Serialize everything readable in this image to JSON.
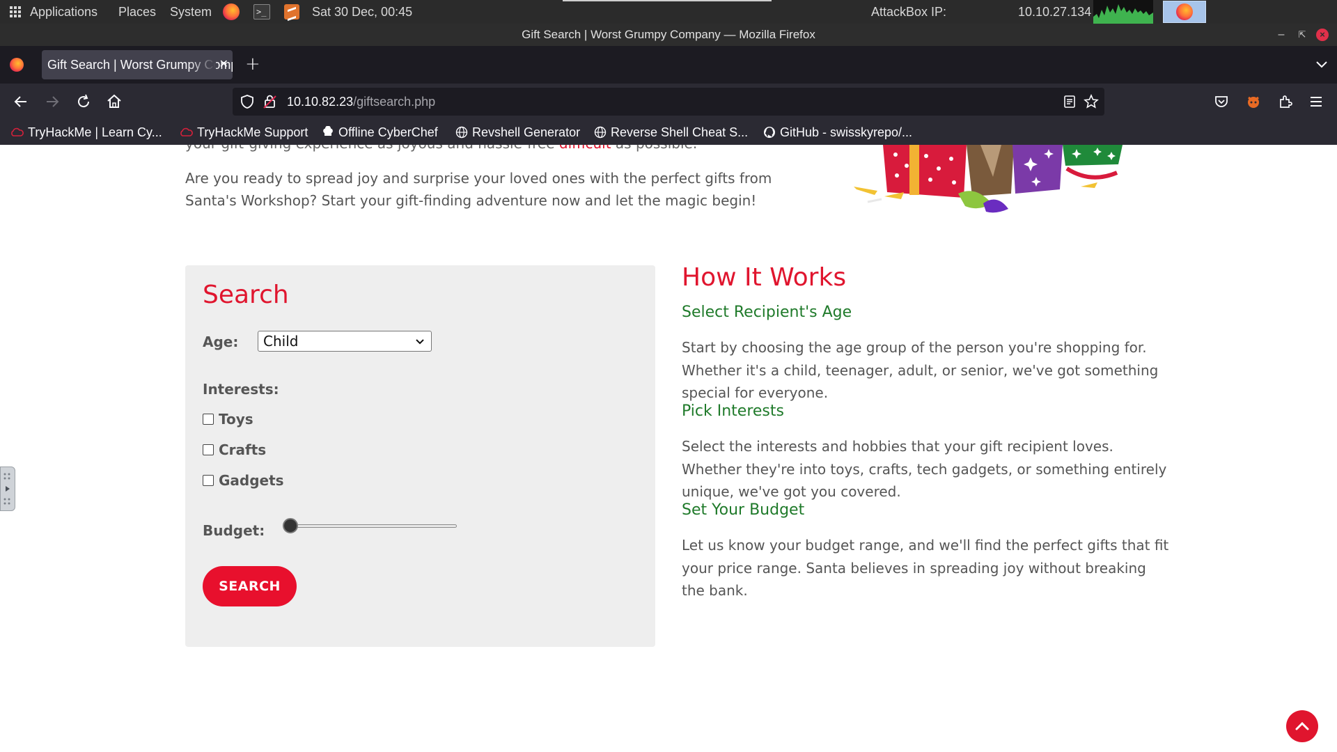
{
  "panel": {
    "applications": "Applications",
    "places": "Places",
    "system": "System",
    "clock": "Sat 30 Dec, 00:45",
    "attackbox_label": "AttackBox IP:",
    "attackbox_ip": "10.10.27.134"
  },
  "window": {
    "title": "Gift Search | Worst Grumpy Company — Mozilla Firefox"
  },
  "browser": {
    "tab_title": "Gift Search | Worst Grumpy Company",
    "url_host": "10.10.82.23",
    "url_path": "/giftsearch.php",
    "bookmarks": [
      {
        "label": "TryHackMe | Learn Cy...",
        "icon": "cloud-icon"
      },
      {
        "label": "TryHackMe Support",
        "icon": "cloud-icon"
      },
      {
        "label": "Offline CyberChef",
        "icon": "chef-hat-icon"
      },
      {
        "label": "Revshell Generator",
        "icon": "globe-icon"
      },
      {
        "label": "Reverse Shell Cheat S...",
        "icon": "globe-icon"
      },
      {
        "label": "GitHub - swisskyrepo/...",
        "icon": "github-icon"
      }
    ]
  },
  "page": {
    "clipped_before": "your gift-giving experience as joyous and hassle-free",
    "clipped_highlight": "difficult",
    "clipped_after": "as possible.",
    "intro": "Are you ready to spread joy and surprise your loved ones with the perfect gifts from Santa's Workshop? Start your gift-finding adventure now and let the magic begin!",
    "search": {
      "title": "Search",
      "age_label": "Age:",
      "age_value": "Child",
      "interests_label": "Interests:",
      "interests": [
        "Toys",
        "Crafts",
        "Gadgets"
      ],
      "interests_checked": [
        false,
        false,
        false
      ],
      "budget_label": "Budget:",
      "budget_fraction": 0,
      "button": "SEARCH"
    },
    "how": {
      "title": "How It Works",
      "steps": [
        {
          "heading": "Select Recipient's Age",
          "text": "Start by choosing the age group of the person you're shopping for. Whether it's a child, teenager, adult, or senior, we've got something special for everyone."
        },
        {
          "heading": "Pick Interests",
          "text": "Select the interests and hobbies that your gift recipient loves. Whether they're into toys, crafts, tech gadgets, or something entirely unique, we've got you covered."
        },
        {
          "heading": "Set Your Budget",
          "text": "Let us know your budget range, and we'll find the perfect gifts that fit your price range. Santa believes in spreading joy without breaking the bank."
        }
      ]
    }
  },
  "colors": {
    "brand_red": "#e0152e",
    "heading_green": "#1f7a2a",
    "card_bg": "#eeeeee"
  }
}
